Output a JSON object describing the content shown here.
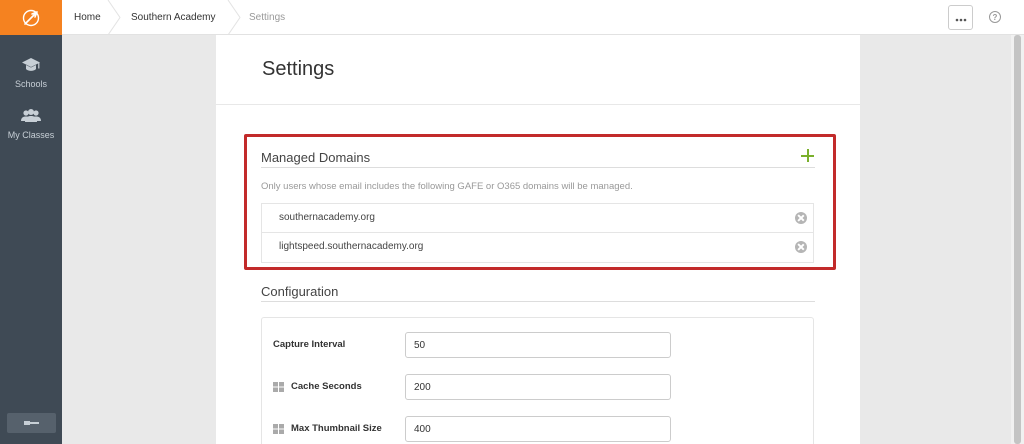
{
  "sidebar": {
    "items": [
      {
        "id": "schools",
        "label": "Schools",
        "icon": "graduation-cap-icon"
      },
      {
        "id": "my-classes",
        "label": "My Classes",
        "icon": "users-icon"
      }
    ],
    "bottom_icon": "key-icon",
    "logo_icon": "compass-logo-icon"
  },
  "topbar": {
    "breadcrumbs": [
      "Home",
      "Southern Academy",
      "Settings"
    ],
    "more_icon": "ellipsis-icon",
    "help_label": "?"
  },
  "page": {
    "title": "Settings"
  },
  "managed_domains": {
    "title": "Managed Domains",
    "description": "Only users whose email includes the following GAFE or O365 domains will be managed.",
    "add_icon": "plus-icon",
    "domains": [
      "southernacademy.org",
      "lightspeed.southernacademy.org"
    ]
  },
  "configuration": {
    "title": "Configuration",
    "fields": [
      {
        "label": "Capture Interval",
        "value": "50",
        "windows_icon": false
      },
      {
        "label": "Cache Seconds",
        "value": "200",
        "windows_icon": true
      },
      {
        "label": "Max Thumbnail Size",
        "value": "400",
        "windows_icon": true
      }
    ]
  },
  "colors": {
    "accent": "#f58220",
    "sidebar": "#3f4a55",
    "highlight": "#c22a2a",
    "add": "#7ab02c"
  }
}
